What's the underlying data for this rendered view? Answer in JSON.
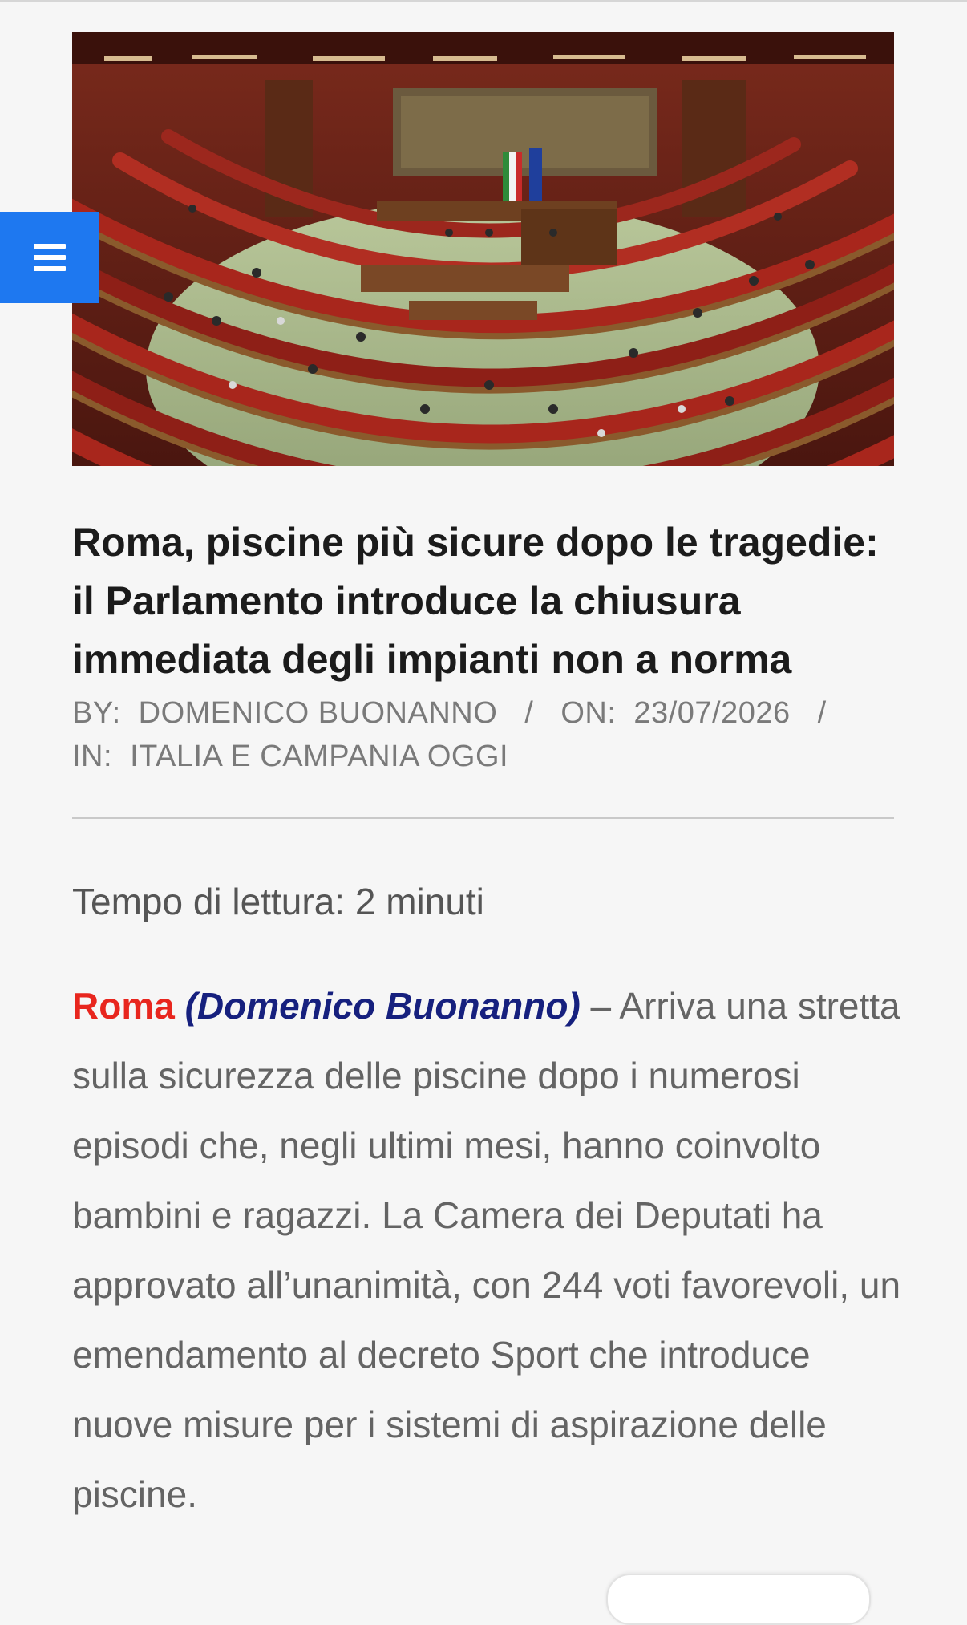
{
  "hero_image": {
    "alt": "Aula della Camera dei Deputati"
  },
  "menu": {
    "icon": "hamburger-menu-icon"
  },
  "article": {
    "title": "Roma, piscine più sicure dopo le tragedie: il Parlamento introduce la chiusura immediata degli impianti non a norma",
    "meta": {
      "by_label": "BY:",
      "author": "DOMENICO BUONANNO",
      "separator": "/",
      "on_label": "ON:",
      "date": "23/07/2026",
      "in_label": "IN:",
      "category": "ITALIA E CAMPANIA OGGI"
    },
    "reading_time": "Tempo di lettura: 2 minuti",
    "lead": {
      "place": "Roma",
      "author": "(Domenico Buonanno)",
      "text": " – Arriva una stretta sulla sicurezza delle piscine dopo i numerosi episodi che, negli ultimi mesi, hanno coinvolto bambini e ragazzi. La Camera dei Deputati ha approvato all’unanimità, con 244 voti favorevoli, un emendamento al decreto Sport che introduce nuove misure per i sistemi di aspirazione delle piscine."
    }
  },
  "colors": {
    "menu_button": "#1e78f0",
    "place_red": "#e8261e",
    "author_navy": "#16207e",
    "title_text": "#1b1b1b",
    "meta_gray": "#7a7a7a",
    "body_gray": "#646464"
  }
}
